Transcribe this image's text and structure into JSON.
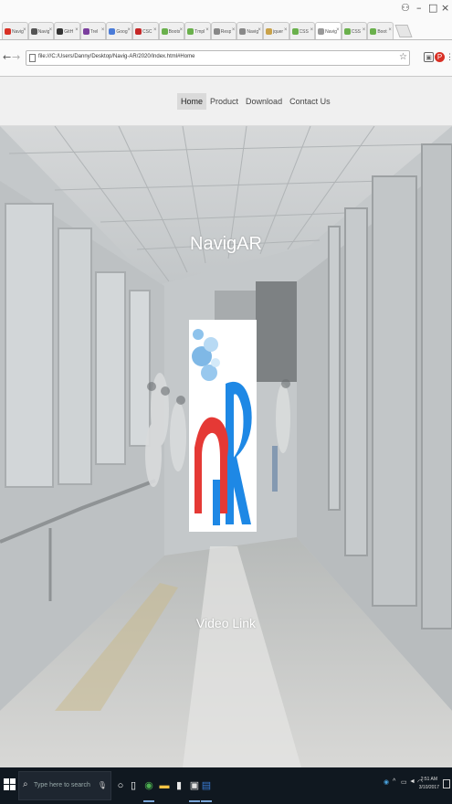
{
  "browser": {
    "window_controls": {
      "user_icon": "user-icon",
      "minimize": "–",
      "maximize": "□",
      "close": "×"
    },
    "tabs": [
      {
        "label": "Navig",
        "color": "#d93025",
        "active": false
      },
      {
        "label": "Navig",
        "color": "#555555",
        "active": false
      },
      {
        "label": "GitH",
        "color": "#333333",
        "active": false
      },
      {
        "label": "Trel",
        "color": "#7b3f9e",
        "active": false
      },
      {
        "label": "Goog",
        "color": "#4a7bd8",
        "active": false
      },
      {
        "label": "CSC",
        "color": "#c62828",
        "active": false
      },
      {
        "label": "Boots",
        "color": "#6ab04c",
        "active": false
      },
      {
        "label": "Tmpl",
        "color": "#6ab04c",
        "active": false
      },
      {
        "label": "Resp",
        "color": "#888888",
        "active": false
      },
      {
        "label": "Navig",
        "color": "#888888",
        "active": false
      },
      {
        "label": "jquer",
        "color": "#c9a24a",
        "active": false
      },
      {
        "label": "CSS",
        "color": "#6ab04c",
        "active": false
      },
      {
        "label": "Navig",
        "color": "#999999",
        "active": true
      },
      {
        "label": "CSS",
        "color": "#6ab04c",
        "active": false
      },
      {
        "label": "Boot",
        "color": "#6ab04c",
        "active": false
      }
    ],
    "address": {
      "url": "file:///C:/Users/Danny/Desktop/Navig-AR/2020/Index.html#Home"
    },
    "nav_back": "←",
    "nav_forward": "→",
    "nav_reload": "↻"
  },
  "site": {
    "nav": [
      {
        "label": "Home",
        "active": true
      },
      {
        "label": "Product",
        "active": false
      },
      {
        "label": "Download",
        "active": false
      },
      {
        "label": "Contact Us",
        "active": false
      }
    ],
    "hero": {
      "title": "NavigAR",
      "video_link": "Video Link"
    }
  },
  "taskbar": {
    "search_placeholder": "Type here to search",
    "clock_time": "2:51 AM",
    "clock_date": "3/10/2017"
  }
}
